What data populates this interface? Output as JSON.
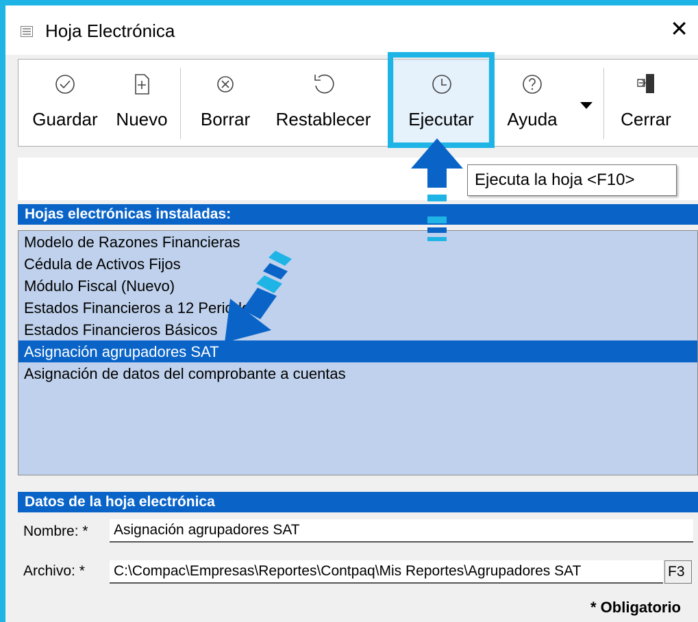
{
  "window": {
    "title": "Hoja Electrónica",
    "close_glyph": "✕"
  },
  "toolbar": {
    "guardar": "Guardar",
    "nuevo": "Nuevo",
    "borrar": "Borrar",
    "restablecer": "Restablecer",
    "ejecutar": "Ejecutar",
    "ayuda": "Ayuda",
    "cerrar": "Cerrar"
  },
  "tooltip": "Ejecuta la hoja <F10>",
  "sheets": {
    "header": "Hojas electrónicas instaladas:",
    "items": [
      "Modelo de Razones Financieras",
      "Cédula de Activos Fijos",
      "Módulo Fiscal (Nuevo)",
      "Estados Financieros a 12 Periodos",
      "Estados Financieros Básicos",
      "Asignación agrupadores SAT",
      "Asignación de datos del comprobante a cuentas"
    ],
    "selected_index": 5
  },
  "details": {
    "header": "Datos de la hoja electrónica",
    "nombre_label": "Nombre: *",
    "nombre_value": "Asignación agrupadores SAT",
    "archivo_label": "Archivo: *",
    "archivo_value": "C:\\Compac\\Empresas\\Reportes\\Contpaq\\Mis Reportes\\Agrupadores SAT",
    "browse_label": "F3",
    "required_note": "* Obligatorio"
  },
  "colors": {
    "accent": "#1eb4e6",
    "arrow": "#0a64c8",
    "selection": "#0a64c8",
    "list_bg": "#bfd1ec"
  }
}
